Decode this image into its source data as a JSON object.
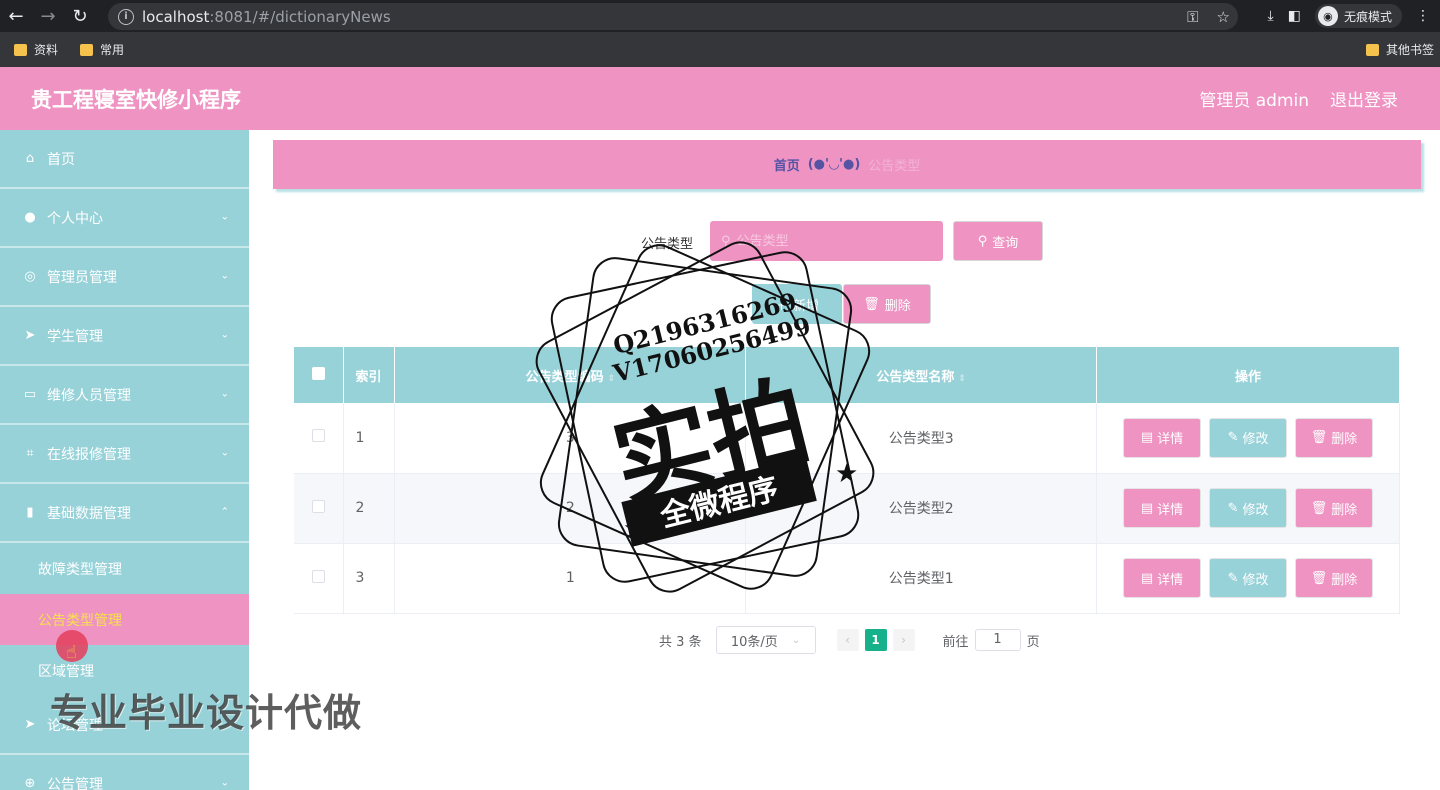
{
  "browser": {
    "url_host": "localhost",
    "url_path": ":8081/#/dictionaryNews",
    "incognito_label": "无痕模式",
    "bookmarks": [
      "资料",
      "常用"
    ],
    "other_bookmarks": "其他书签"
  },
  "header": {
    "title": "贵工程寝室快修小程序",
    "user": "管理员 admin",
    "logout": "退出登录"
  },
  "sidebar": {
    "items": [
      {
        "label": "首页",
        "icon": "home-icon"
      },
      {
        "label": "个人中心",
        "icon": "user-icon"
      },
      {
        "label": "管理员管理",
        "icon": "compass-icon"
      },
      {
        "label": "学生管理",
        "icon": "send-icon"
      },
      {
        "label": "维修人员管理",
        "icon": "card-icon"
      },
      {
        "label": "在线报修管理",
        "icon": "crop-icon"
      },
      {
        "label": "基础数据管理",
        "icon": "chart-icon"
      }
    ],
    "subitems": [
      "故障类型管理",
      "公告类型管理",
      "区域管理"
    ],
    "bottom_items": [
      {
        "label": "论坛管理",
        "icon": "send-icon"
      },
      {
        "label": "公告管理",
        "icon": "globe-icon"
      }
    ]
  },
  "breadcrumb": {
    "home": "首页",
    "face": "(●'◡'●)",
    "current": "公告类型"
  },
  "search": {
    "label": "公告类型",
    "placeholder": "公告类型",
    "button": "查询"
  },
  "actions": {
    "add": "新增",
    "delete": "删除"
  },
  "table": {
    "headers": {
      "index": "索引",
      "code": "公告类型编码",
      "name": "公告类型名称",
      "ops": "操作"
    },
    "rows": [
      {
        "index": "1",
        "code": "3",
        "name": "公告类型3"
      },
      {
        "index": "2",
        "code": "2",
        "name": "公告类型2"
      },
      {
        "index": "3",
        "code": "1",
        "name": "公告类型1"
      }
    ],
    "ops": {
      "detail": "详情",
      "edit": "修改",
      "delete": "删除"
    }
  },
  "pager": {
    "total": "共 3 条",
    "size": "10条/页",
    "current": "1",
    "goto_prefix": "前往",
    "goto_value": "1",
    "goto_suffix": "页"
  },
  "overlay": {
    "stamp_line1": "Q2196316269",
    "stamp_line2": "V17060256499",
    "stamp_big": "实拍",
    "stamp_ribbon": "全微程序",
    "watermark": "专业毕业设计代做"
  }
}
